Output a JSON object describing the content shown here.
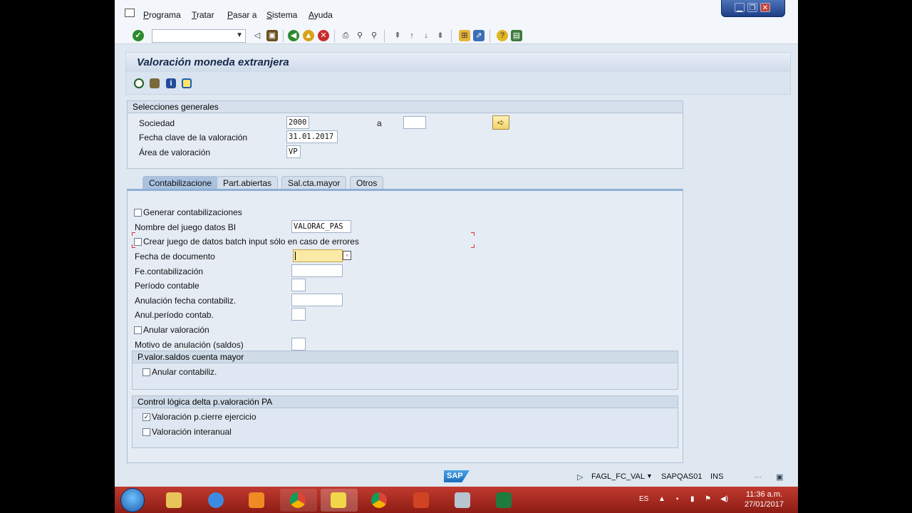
{
  "menu": [
    "Programa",
    "Tratar",
    "Pasar a",
    "Sistema",
    "Ayuda"
  ],
  "title": "Valoración moneda extranjera",
  "selecciones": {
    "header": "Selecciones generales",
    "sociedad_label": "Sociedad",
    "sociedad_value": "2000",
    "a_label": "a",
    "a_value": "",
    "fecha_label": "Fecha clave de la valoración",
    "fecha_value": "31.01.2017",
    "area_label": "Área de valoración",
    "area_value": "VP"
  },
  "tabs": [
    "Contabilizacione",
    "Part.abiertas",
    "Sal.cta.mayor",
    "Otros"
  ],
  "contab": {
    "generar": {
      "label": "Generar contabilizaciones",
      "checked": false
    },
    "nombre_label": "Nombre del juego datos BI",
    "nombre_value": "VALORAC_PAS",
    "crear": {
      "label": "Crear juego de datos batch input sólo en caso de errores",
      "checked": false
    },
    "fecha_doc_label": "Fecha de documento",
    "fe_contab_label": "Fe.contabilización",
    "periodo_label": "Período contable",
    "anul_fecha_label": "Anulación fecha contabiliz.",
    "anul_periodo_label": "Anul.período contab.",
    "anular_val": {
      "label": "Anular valoración",
      "checked": false
    },
    "motivo_label": "Motivo de anulación (saldos)"
  },
  "grp_saldos": {
    "header": "P.valor.saldos cuenta mayor",
    "anular_contab": {
      "label": "Anular contabiliz.",
      "checked": false
    }
  },
  "grp_control": {
    "header": "Control lógica delta p.valoración PA",
    "cierre": {
      "label": "Valoración p.cierre ejercicio",
      "checked": true
    },
    "interanual": {
      "label": "Valoración interanual",
      "checked": false
    }
  },
  "status": {
    "logo": "SAP",
    "transaction": "FAGL_FC_VAL",
    "server": "SAPQAS01",
    "mode": "INS"
  },
  "taskbar": {
    "lang": "ES",
    "time": "11:36 a.m.",
    "date": "27/01/2017"
  }
}
